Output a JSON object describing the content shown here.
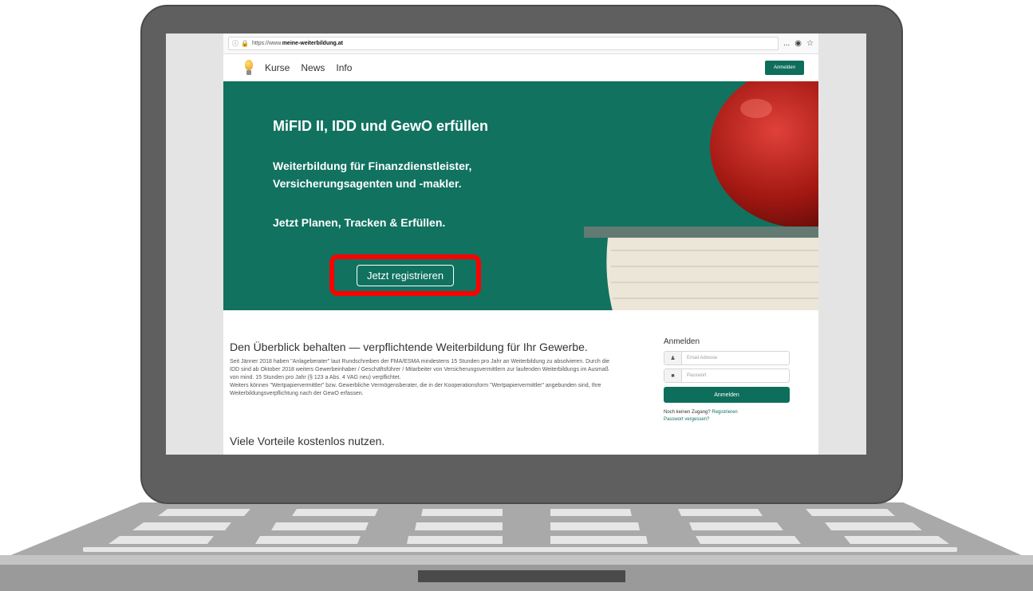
{
  "browser": {
    "url_prefix": "https://www.",
    "url_domain": "meine-weiterbildung.at",
    "info_icon": "info-icon",
    "lock_icon": "lock-icon",
    "actions": [
      "...",
      "pocket-icon",
      "star-icon"
    ]
  },
  "nav": {
    "items": [
      "Kurse",
      "News",
      "Info"
    ],
    "login_button": "Anmelden"
  },
  "hero": {
    "title": "MiFID II, IDD und GewO erfüllen",
    "line1": "Weiterbildung für Finanzdienstleister,",
    "line2": "Versicherungsagenten und -makler.",
    "line3": "Jetzt Planen, Tracken & Erfüllen.",
    "cta": "Jetzt registrieren",
    "highlight_color": "#ff0000",
    "background_color": "#117260"
  },
  "content": {
    "title": "Den Überblick behalten — verpflichtende Weiterbildung für Ihr Gewerbe.",
    "paragraph1": "Seit Jänner 2018 haben \"Anlageberater\" laut Rundschreiben der FMA/ESMA mindestens 15 Stunden pro Jahr an Weiterbildung zu absolvieren. Durch die IDD sind ab Oktober 2018 weiters Gewerbeinhaber / Geschäftsführer / Mitarbeiter von Versicherungsvermittlern zur laufenden Weiterbildungs im Ausmaß von mind. 15 Stunden pro Jahr (§ 123 a Abs. 4 VAG neu) verpflichtet.",
    "paragraph2": "Weiters können \"Wertpapiervermittler\" bzw. Gewerbliche Vermögensberater, die in der Kooperationsform \"Wertpapiervermittler\" angebunden sind, Ihre Weiterbildungsverpflichtung nach der GewO erfassen.",
    "subtitle": "Viele Vorteile kostenlos nutzen."
  },
  "login": {
    "title": "Anmelden",
    "email_placeholder": "Email Adresse",
    "password_placeholder": "Passwort",
    "button": "Anmelden",
    "no_account": "Noch keinen Zugang?",
    "register_link": "Registrieren",
    "forgot_link": "Passwort vergessen?"
  },
  "colors": {
    "brand": "#0e6e5c"
  }
}
